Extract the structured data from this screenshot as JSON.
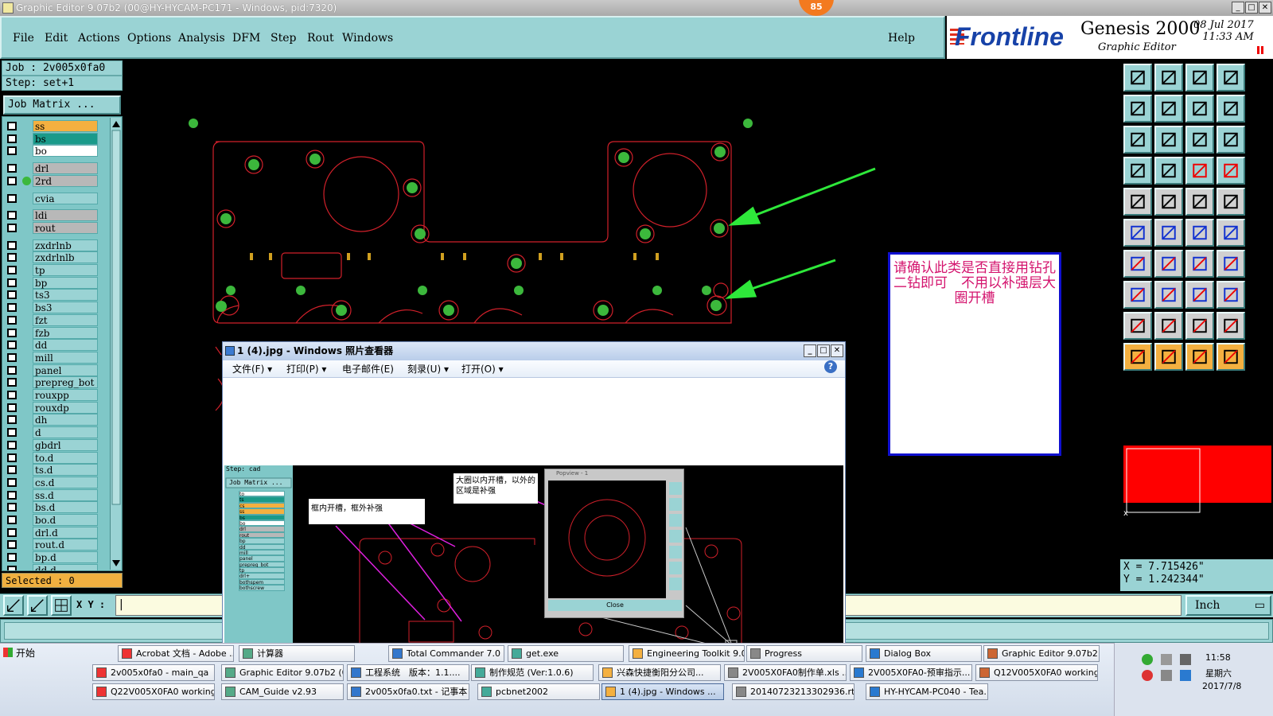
{
  "window": {
    "title": "Graphic Editor 9.07b2 (00@HY-HYCAM-PC171 - Windows, pid:7320)",
    "badge": "85"
  },
  "menu": {
    "items": [
      "File",
      "Edit",
      "Actions",
      "Options",
      "Analysis",
      "DFM",
      "Step",
      "Rout",
      "Windows"
    ],
    "help": "Help"
  },
  "brand": {
    "logo": "Frontline",
    "product": "Genesis 2000",
    "module": "Graphic Editor",
    "date": "08 Jul 2017",
    "time": "11:33 AM"
  },
  "job": {
    "job_line": "Job : 2v005x0fa0",
    "step_line": "Step: set+1",
    "matrix_button": "Job Matrix ..."
  },
  "layers": [
    {
      "name": "ss",
      "color": "#f4b040"
    },
    {
      "name": "bs",
      "color": "#1a9a8a"
    },
    {
      "name": "bo",
      "color": "#ffffff"
    },
    {
      "name": "drl",
      "color": "#b8b8b8"
    },
    {
      "name": "2rd",
      "color": "#b8b8b8"
    },
    {
      "name": "cvia",
      "color": "#9ad3d4"
    },
    {
      "name": "ldi",
      "color": "#b8b8b8"
    },
    {
      "name": "rout",
      "color": "#b8b8b8"
    },
    {
      "name": "zxdrlnb",
      "color": "#9ad3d4"
    },
    {
      "name": "zxdrlnlb",
      "color": "#9ad3d4"
    },
    {
      "name": "tp",
      "color": "#9ad3d4"
    },
    {
      "name": "bp",
      "color": "#9ad3d4"
    },
    {
      "name": "ts3",
      "color": "#9ad3d4"
    },
    {
      "name": "bs3",
      "color": "#9ad3d4"
    },
    {
      "name": "fzt",
      "color": "#9ad3d4"
    },
    {
      "name": "fzb",
      "color": "#9ad3d4"
    },
    {
      "name": "dd",
      "color": "#9ad3d4"
    },
    {
      "name": "mill",
      "color": "#9ad3d4"
    },
    {
      "name": "panel",
      "color": "#9ad3d4"
    },
    {
      "name": "prepreg_bot",
      "color": "#9ad3d4"
    },
    {
      "name": "rouxpp",
      "color": "#9ad3d4"
    },
    {
      "name": "rouxdp",
      "color": "#9ad3d4"
    },
    {
      "name": "dh",
      "color": "#9ad3d4"
    },
    {
      "name": "d",
      "color": "#9ad3d4"
    },
    {
      "name": "gbdrl",
      "color": "#9ad3d4"
    },
    {
      "name": "to.d",
      "color": "#9ad3d4"
    },
    {
      "name": "ts.d",
      "color": "#9ad3d4"
    },
    {
      "name": "cs.d",
      "color": "#9ad3d4"
    },
    {
      "name": "ss.d",
      "color": "#9ad3d4"
    },
    {
      "name": "bs.d",
      "color": "#9ad3d4"
    },
    {
      "name": "bo.d",
      "color": "#9ad3d4"
    },
    {
      "name": "drl.d",
      "color": "#9ad3d4"
    },
    {
      "name": "rout.d",
      "color": "#9ad3d4"
    },
    {
      "name": "bp.d",
      "color": "#9ad3d4"
    },
    {
      "name": "dd.d",
      "color": "#9ad3d4"
    }
  ],
  "selected": "Selected : 0",
  "coords": {
    "x": "X = 7.715426\"",
    "y": "Y = 1.242344\""
  },
  "xy_label": "X Y :",
  "units": "Inch",
  "note": "请确认此类是否直接用钻孔二钻即可　不用以补强层大圈开槽",
  "photo_viewer": {
    "title": "1 (4).jpg - Windows 照片查看器",
    "menu": [
      "文件(F) ▾",
      "打印(P) ▾",
      "电子邮件(E)",
      "刻录(U) ▾",
      "打开(O) ▾"
    ],
    "help": "?",
    "inner": {
      "step": "Step: cad",
      "matrix": "Job Matrix ...",
      "layers": [
        "to",
        "ts",
        "cs",
        "ss",
        "bs",
        "bo",
        "drl",
        "rout",
        "bp",
        "dd",
        "mill",
        "panel",
        "prepreg_bot",
        "tp",
        "drl+",
        "bothspem",
        "bothscrew"
      ],
      "note1": "框内开槽，框外补强",
      "note2": "大圈以内开槽，以外的区域是补强",
      "popview_title": "Popview - 1",
      "close": "Close"
    }
  },
  "taskbar": {
    "start": "开始",
    "row1": [
      "Acrobat 文档 - Adobe ...",
      "计算器",
      "Total Commander 7.0 ...",
      "get.exe",
      "Engineering Toolkit 9.0...",
      "Progress",
      "Dialog Box",
      "Graphic Editor 9.07b2 ..."
    ],
    "row2": [
      "2v005x0fa0 - main_qa",
      "Graphic Editor 9.07b2 (0...",
      "工程系统　版本：1.1....",
      "制作规范 (Ver:1.0.6)",
      "兴森快捷衡阳分公司...",
      "2V005X0FA0制作单.xls ...",
      "2V005X0FA0-预审指示...",
      "Q12V005X0FA0 working ..."
    ],
    "row3": [
      "Q22V005X0FA0 working ...",
      "CAM_Guide v2.93",
      "2v005x0fa0.txt - 记事本",
      "pcbnet2002",
      "1 (4).jpg - Windows ...",
      "20140723213302936.rtf...",
      "HY-HYCAM-PC040 - Tea..."
    ],
    "clock": "11:58",
    "weekday": "星期六",
    "date": "2017/7/8"
  }
}
